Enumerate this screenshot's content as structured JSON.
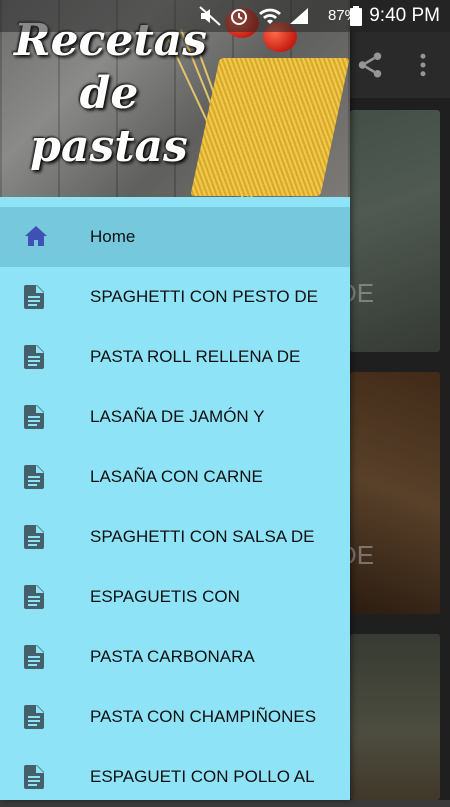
{
  "status_bar": {
    "battery_percent": "87%",
    "time": "9:40 PM"
  },
  "background": {
    "card_texts": [
      "DE",
      "DE"
    ]
  },
  "drawer": {
    "header_title": [
      "Recetas",
      "de",
      "pastas"
    ],
    "items": [
      {
        "label": "Home",
        "icon": "home-icon",
        "selected": true
      },
      {
        "label": "SPAGHETTI CON PESTO DE",
        "icon": "document-icon"
      },
      {
        "label": "PASTA ROLL RELLENA DE",
        "icon": "document-icon"
      },
      {
        "label": "LASAÑA DE JAMÓN Y",
        "icon": "document-icon"
      },
      {
        "label": "LASAÑA CON CARNE",
        "icon": "document-icon"
      },
      {
        "label": "SPAGHETTI CON SALSA DE",
        "icon": "document-icon"
      },
      {
        "label": "ESPAGUETIS CON",
        "icon": "document-icon"
      },
      {
        "label": "PASTA CARBONARA",
        "icon": "document-icon"
      },
      {
        "label": "PASTA CON CHAMPIÑONES",
        "icon": "document-icon"
      },
      {
        "label": "ESPAGUETI CON POLLO AL",
        "icon": "document-icon"
      }
    ]
  },
  "colors": {
    "drawer_bg": "#8ee3f7",
    "selected_bg": "#76c8dc",
    "home_icon": "#3f51b5",
    "doc_icon": "#44616b"
  }
}
